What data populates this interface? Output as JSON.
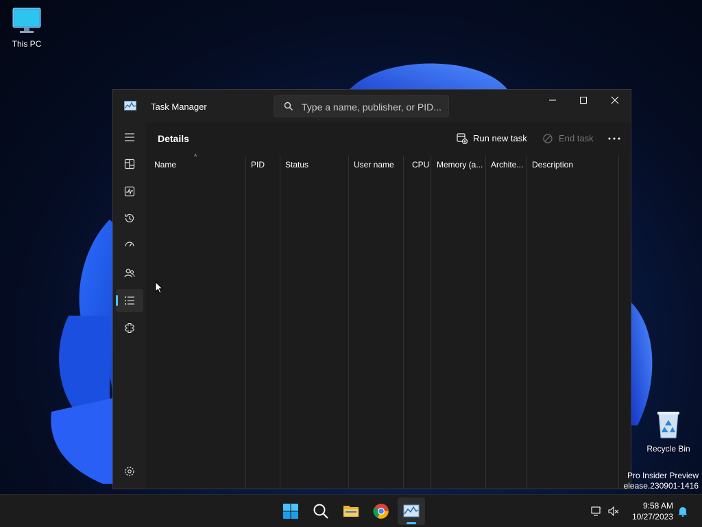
{
  "desktop": {
    "icons": [
      {
        "label": "This PC"
      },
      {
        "label": "Recycle Bin"
      }
    ],
    "watermark_line1": "Pro Insider Preview",
    "watermark_line2": "elease.230901-1416"
  },
  "window": {
    "title": "Task Manager",
    "search_placeholder": "Type a name, publisher, or PID...",
    "page_title": "Details",
    "run_new_task": "Run new task",
    "end_task": "End task",
    "columns": [
      "Name",
      "PID",
      "Status",
      "User name",
      "CPU",
      "Memory (a...",
      "Archite...",
      "Description"
    ],
    "sort_indicator": "^",
    "nav_items": [
      "menu-icon",
      "processes-icon",
      "performance-icon",
      "app-history-icon",
      "startup-apps-icon",
      "users-icon",
      "details-icon",
      "services-icon",
      "settings-icon"
    ],
    "active_nav": "details-icon"
  },
  "taskbar": {
    "apps": [
      "start-icon",
      "search-icon",
      "file-explorer-icon",
      "chrome-icon",
      "task-manager-icon"
    ],
    "time": "9:58 AM",
    "date": "10/27/2023"
  },
  "colors": {
    "accent": "#4cc2ff",
    "window_bg": "#1c1c1c",
    "taskbar_bg": "#1c1c1c"
  }
}
